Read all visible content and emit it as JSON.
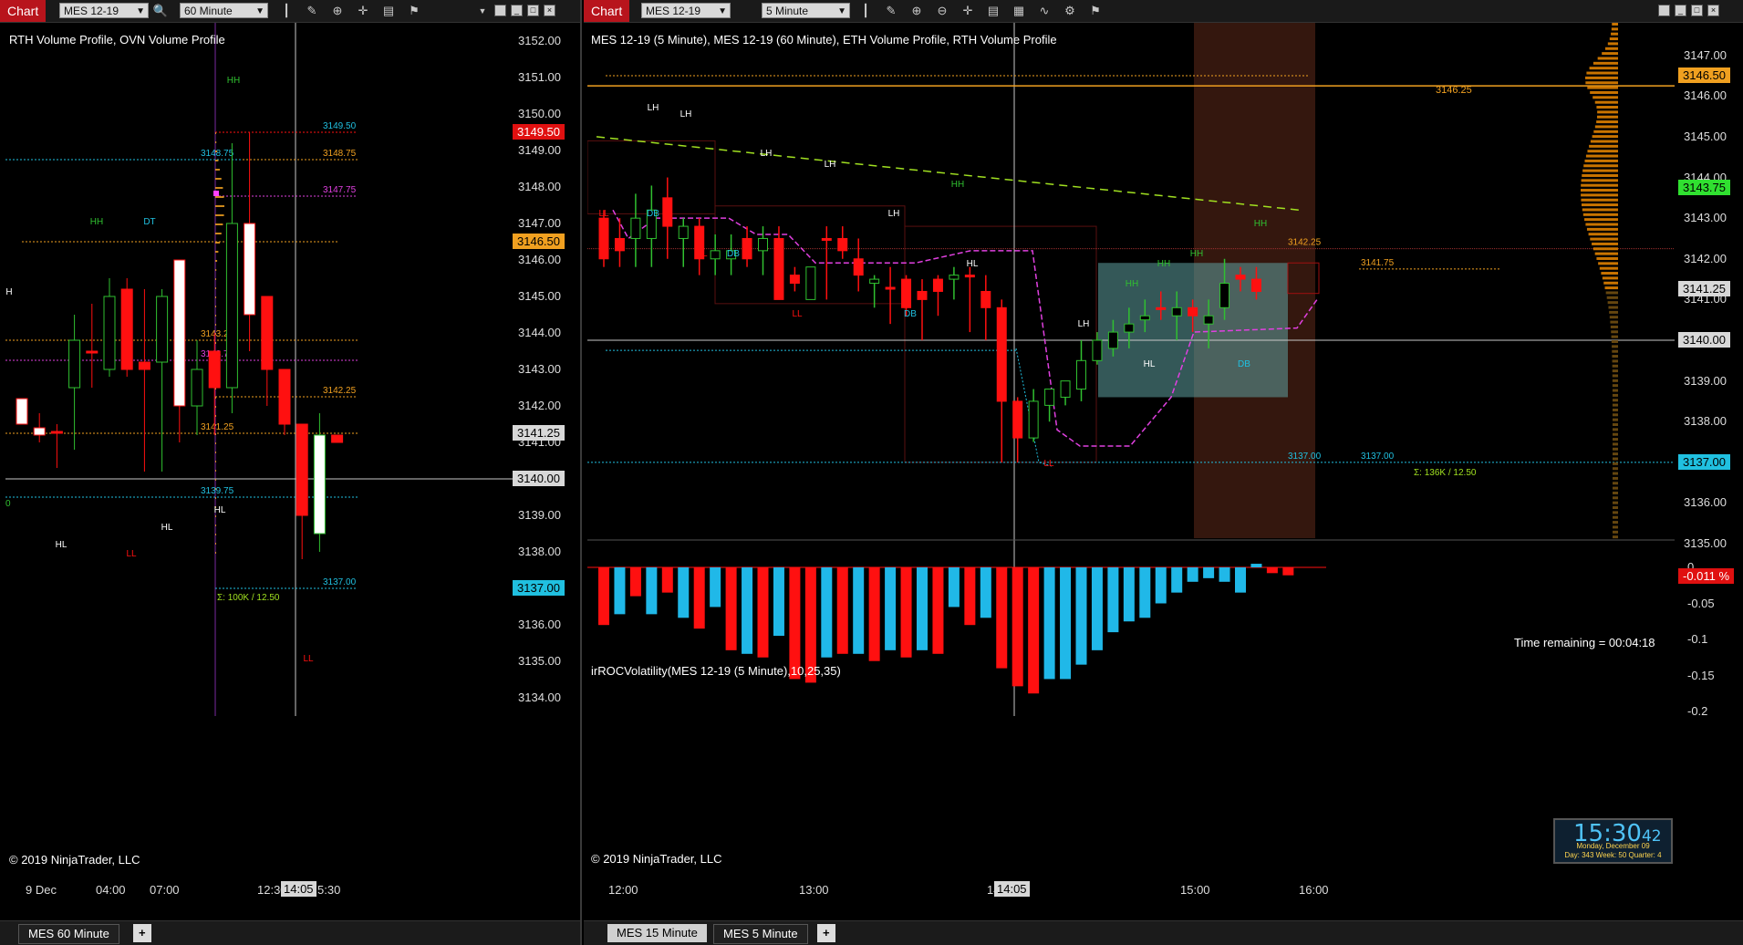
{
  "left": {
    "toolbar": {
      "chart_label": "Chart",
      "instrument": "MES 12-19",
      "interval": "60 Minute"
    },
    "title": "RTH Volume Profile, OVN Volume Profile",
    "copyright": "© 2019 NinjaTrader, LLC",
    "y_ticks": [
      "3152.00",
      "3151.00",
      "3150.00",
      "3149.00",
      "3148.00",
      "3147.00",
      "3146.00",
      "3145.00",
      "3144.00",
      "3143.00",
      "3142.00",
      "3141.00",
      "3139.00",
      "3138.00",
      "3137.00",
      "3136.00",
      "3135.00",
      "3134.00"
    ],
    "y_badges": [
      {
        "text": "3149.50",
        "bg": "#e01010",
        "fg": "#ffffff"
      },
      {
        "text": "3146.50",
        "bg": "#f0a020",
        "fg": "#000000"
      },
      {
        "text": "3141.25",
        "bg": "#d8d8d8",
        "fg": "#000000"
      },
      {
        "text": "3140.00",
        "bg": "#d8d8d8",
        "fg": "#000000"
      },
      {
        "text": "3137.00",
        "bg": "#20c0e0",
        "fg": "#000000"
      }
    ],
    "x_ticks": [
      "9 Dec",
      "04:00",
      "07:00",
      "12:30",
      "5:30"
    ],
    "x_cursor": "14:05",
    "levels": [
      "3149.50",
      "3148.75",
      "3148.75",
      "3147.75",
      "3143.25",
      "3143.75",
      "3142.25",
      "3141.25",
      "3139.75",
      "3137.00"
    ],
    "sigma": "Σ: 100K / 12.50",
    "markers": [
      "HH",
      "HH",
      "DT",
      "H",
      "HL",
      "HL",
      "LL",
      "HL",
      "LL",
      "00"
    ],
    "tabs": [
      "MES  60 Minute",
      "+"
    ]
  },
  "right": {
    "toolbar": {
      "chart_label": "Chart",
      "instrument": "MES 12-19",
      "interval": "5 Minute"
    },
    "title": "MES 12-19 (5 Minute), MES 12-19 (60 Minute), ETH Volume Profile, RTH Volume Profile",
    "indicator_title": "irROCVolatility(MES 12-19 (5 Minute),10,25,35)",
    "copyright": "© 2019 NinjaTrader, LLC",
    "time_remaining": "Time remaining = 00:04:18",
    "y_ticks": [
      "3147.00",
      "3146.00",
      "3145.00",
      "3144.00",
      "3143.00",
      "3142.00",
      "3141.00",
      "3139.00",
      "3138.00",
      "3137.00",
      "3136.00",
      "3135.00"
    ],
    "y_badges": [
      {
        "text": "3146.50",
        "bg": "#f0a020",
        "fg": "#000000"
      },
      {
        "text": "3143.75",
        "bg": "#30e030",
        "fg": "#000000"
      },
      {
        "text": "3141.25",
        "bg": "#d8d8d8",
        "fg": "#000000"
      },
      {
        "text": "3140.00",
        "bg": "#d8d8d8",
        "fg": "#000000"
      },
      {
        "text": "3137.00",
        "bg": "#20c0e0",
        "fg": "#000000"
      }
    ],
    "ind_ticks": [
      "0",
      "-0.05",
      "-0.1",
      "-0.15",
      "-0.2"
    ],
    "ind_badge": "-0.011 %",
    "x_ticks": [
      "12:00",
      "13:00",
      "14:",
      "15:00",
      "16:00"
    ],
    "x_cursor": "14:05",
    "levels": [
      "3146.25",
      "3142.25",
      "3141.75",
      "3137.00",
      "3137.00"
    ],
    "sigma": "Σ: 136K / 12.50",
    "markers": [
      "LH",
      "LH",
      "LH",
      "LH",
      "LH",
      "LL",
      "DB",
      "LL",
      "DB",
      "LL",
      "DB",
      "HH",
      "HL",
      "LH",
      "LL",
      "HH",
      "HH",
      "HH",
      "HH",
      "HL",
      "DB"
    ],
    "clock": {
      "time": "15:30",
      "sec": "42",
      "line1": "Monday, December 09",
      "line2": "Day: 343  Week: 50  Quarter: 4"
    },
    "tabs": [
      "MES  15 Minute",
      "MES  5 Minute",
      "+"
    ]
  },
  "colors": {
    "up": "#30c030",
    "down": "#ff1010",
    "orange": "#f0a020",
    "cyan": "#20c0e0",
    "magenta": "#e040e0",
    "lime": "#a0e020"
  },
  "chart_data": [
    {
      "type": "candlestick",
      "title": "RTH Volume Profile, OVN Volume Profile",
      "interval": "60 Minute",
      "ylim": [
        3133.5,
        3152.5
      ],
      "ohlc": [
        [
          3142.2,
          3142.2,
          3141.5,
          3141.5
        ],
        [
          3141.4,
          3141.8,
          3141.0,
          3141.2
        ],
        [
          3141.3,
          3141.5,
          3140.3,
          3141.3
        ],
        [
          3142.5,
          3144.5,
          3140.8,
          3143.8
        ],
        [
          3143.5,
          3144.8,
          3142.5,
          3143.5
        ],
        [
          3143.0,
          3145.5,
          3142.8,
          3145.0
        ],
        [
          3145.2,
          3145.5,
          3142.8,
          3143.0
        ],
        [
          3143.2,
          3145.2,
          3140.2,
          3143.0
        ],
        [
          3143.2,
          3145.2,
          3140.2,
          3145.0
        ],
        [
          3146.0,
          3146.0,
          3141.0,
          3142.0
        ],
        [
          3142.0,
          3143.8,
          3141.2,
          3143.0
        ],
        [
          3143.5,
          3144.0,
          3141.2,
          3142.5
        ],
        [
          3142.5,
          3149.2,
          3141.8,
          3147.0
        ],
        [
          3147.0,
          3149.5,
          3143.5,
          3144.5
        ],
        [
          3145.0,
          3145.0,
          3142.0,
          3143.0
        ],
        [
          3143.0,
          3143.0,
          3141.2,
          3141.5
        ],
        [
          3141.5,
          3141.5,
          3137.8,
          3139.0
        ],
        [
          3138.5,
          3141.8,
          3138.0,
          3141.2
        ],
        [
          3141.2,
          3141.2,
          3141.0,
          3141.0
        ]
      ]
    },
    {
      "type": "candlestick",
      "title": "MES 12-19 (5 Minute)",
      "interval": "5 Minute",
      "ylim": [
        3134.8,
        3147.8
      ],
      "ohlc": [
        [
          3143.0,
          3143.2,
          3141.8,
          3142.0
        ],
        [
          3142.5,
          3143.0,
          3141.8,
          3142.2
        ],
        [
          3142.5,
          3143.6,
          3141.8,
          3143.0
        ],
        [
          3142.5,
          3143.8,
          3141.8,
          3143.2
        ],
        [
          3143.5,
          3144.0,
          3142.0,
          3142.8
        ],
        [
          3142.5,
          3143.0,
          3141.8,
          3142.8
        ],
        [
          3142.8,
          3143.0,
          3141.6,
          3142.0
        ],
        [
          3142.0,
          3142.6,
          3141.6,
          3142.2
        ],
        [
          3142.0,
          3142.6,
          3141.6,
          3142.2
        ],
        [
          3142.5,
          3142.8,
          3141.8,
          3142.0
        ],
        [
          3142.2,
          3142.8,
          3141.6,
          3142.5
        ],
        [
          3142.5,
          3142.8,
          3141.8,
          3141.0
        ],
        [
          3141.6,
          3141.8,
          3141.2,
          3141.4
        ],
        [
          3141.0,
          3141.8,
          3141.0,
          3141.8
        ],
        [
          3142.5,
          3142.8,
          3141.0,
          3142.5
        ],
        [
          3142.5,
          3142.8,
          3142.0,
          3142.2
        ],
        [
          3142.0,
          3142.5,
          3141.2,
          3141.6
        ],
        [
          3141.4,
          3141.6,
          3140.8,
          3141.5
        ],
        [
          3141.3,
          3141.8,
          3140.4,
          3141.3
        ],
        [
          3141.5,
          3141.6,
          3140.6,
          3140.8
        ],
        [
          3141.2,
          3141.5,
          3140.0,
          3141.0
        ],
        [
          3141.5,
          3141.6,
          3140.6,
          3141.2
        ],
        [
          3141.5,
          3141.8,
          3141.0,
          3141.6
        ],
        [
          3141.6,
          3141.8,
          3140.2,
          3141.6
        ],
        [
          3141.2,
          3141.6,
          3140.0,
          3140.8
        ],
        [
          3140.8,
          3141.0,
          3137.0,
          3138.5
        ],
        [
          3138.5,
          3138.6,
          3137.0,
          3137.6
        ],
        [
          3137.6,
          3138.8,
          3137.5,
          3138.5
        ],
        [
          3138.4,
          3138.8,
          3138.0,
          3138.8
        ],
        [
          3138.6,
          3139.0,
          3138.4,
          3139.0
        ],
        [
          3138.8,
          3140.0,
          3138.5,
          3139.5
        ],
        [
          3139.5,
          3140.2,
          3139.4,
          3140.0
        ],
        [
          3139.8,
          3140.5,
          3139.6,
          3140.2
        ],
        [
          3140.2,
          3140.8,
          3139.8,
          3140.4
        ],
        [
          3140.5,
          3141.0,
          3140.2,
          3140.6
        ],
        [
          3140.8,
          3141.2,
          3140.5,
          3140.8
        ],
        [
          3140.6,
          3141.2,
          3140.0,
          3140.8
        ],
        [
          3140.8,
          3141.0,
          3140.2,
          3140.6
        ],
        [
          3140.4,
          3141.0,
          3139.8,
          3140.6
        ],
        [
          3140.8,
          3142.0,
          3140.5,
          3141.4
        ],
        [
          3141.6,
          3141.8,
          3141.2,
          3141.5
        ],
        [
          3141.5,
          3141.8,
          3141.0,
          3141.2
        ]
      ]
    },
    {
      "type": "bar",
      "title": "irROCVolatility(MES 12-19 (5 Minute),10,25,35)",
      "ylim": [
        -0.2,
        0.01
      ],
      "values": [
        -0.08,
        -0.065,
        -0.04,
        -0.065,
        -0.035,
        -0.07,
        -0.085,
        -0.055,
        -0.115,
        -0.12,
        -0.125,
        -0.095,
        -0.155,
        -0.16,
        -0.125,
        -0.12,
        -0.12,
        -0.13,
        -0.115,
        -0.125,
        -0.115,
        -0.12,
        -0.055,
        -0.08,
        -0.07,
        -0.14,
        -0.165,
        -0.175,
        -0.155,
        -0.155,
        -0.135,
        -0.115,
        -0.09,
        -0.075,
        -0.07,
        -0.05,
        -0.035,
        -0.02,
        -0.015,
        -0.02,
        -0.035,
        0.005,
        -0.008,
        -0.011
      ],
      "colors": [
        "r",
        "c",
        "r",
        "c",
        "r",
        "c",
        "r",
        "c",
        "r",
        "c",
        "r",
        "c",
        "r",
        "r",
        "c",
        "r",
        "c",
        "r",
        "c",
        "r",
        "c",
        "r",
        "c",
        "r",
        "c",
        "r",
        "r",
        "r",
        "c",
        "c",
        "c",
        "c",
        "c",
        "c",
        "c",
        "c",
        "c",
        "c",
        "c",
        "c",
        "c",
        "c",
        "r",
        "r"
      ]
    }
  ]
}
